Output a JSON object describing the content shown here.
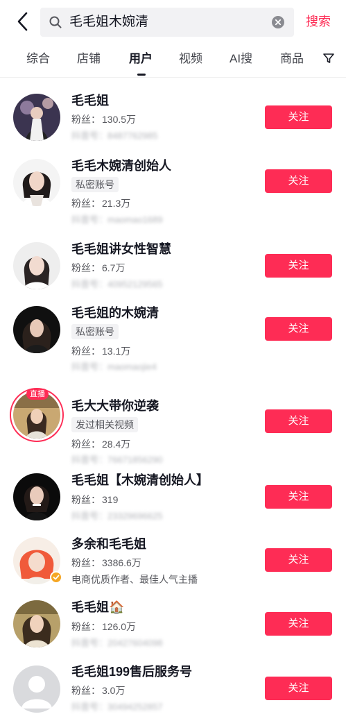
{
  "search": {
    "query": "毛毛姐木婉清",
    "button_label": "搜索"
  },
  "tabs": [
    {
      "label": "综合"
    },
    {
      "label": "店铺"
    },
    {
      "label": "用户",
      "active": true
    },
    {
      "label": "视频"
    },
    {
      "label": "AI搜"
    },
    {
      "label": "商品"
    }
  ],
  "colors": {
    "accent": "#fe2c55",
    "text": "#161823",
    "secondary": "#57585e"
  },
  "users": [
    {
      "name": "毛毛姐",
      "fans_label": "粉丝：",
      "fans": "130.5万",
      "uid": "抖音号：8487762985",
      "follow": "关注"
    },
    {
      "name": "毛毛木婉清创始人",
      "tag": "私密账号",
      "fans_label": "粉丝：",
      "fans": "21.3万",
      "uid": "抖音号：maomao1689",
      "follow": "关注"
    },
    {
      "name": "毛毛姐讲女性智慧",
      "fans_label": "粉丝：",
      "fans": "6.7万",
      "uid": "抖音号：40952129565",
      "follow": "关注"
    },
    {
      "name": "毛毛姐的木婉清",
      "tag": "私密账号",
      "fans_label": "粉丝：",
      "fans": "13.1万",
      "uid": "抖音号：maomaojie4",
      "follow": "关注"
    },
    {
      "name": "毛大大带你逆袭",
      "live": "直播",
      "tag": "发过相关视频",
      "fans_label": "粉丝：",
      "fans": "28.4万",
      "uid": "抖音号：76671856290",
      "follow": "关注"
    },
    {
      "name": "毛毛姐【木婉清创始人】",
      "fans_label": "粉丝：",
      "fans": "319",
      "uid": "抖音号：23329696625",
      "follow": "关注"
    },
    {
      "name": "多余和毛毛姐",
      "fans_label": "粉丝：",
      "fans": "3386.6万",
      "desc": "电商优质作者、最佳人气主播",
      "follow": "关注"
    },
    {
      "name": "毛毛姐🏠",
      "fans_label": "粉丝：",
      "fans": "126.0万",
      "uid": "抖音号：20427604098",
      "follow": "关注"
    },
    {
      "name": "毛毛姐199售后服务号",
      "fans_label": "粉丝：",
      "fans": "3.0万",
      "uid": "抖音号：30494252857",
      "follow": "关注"
    }
  ]
}
